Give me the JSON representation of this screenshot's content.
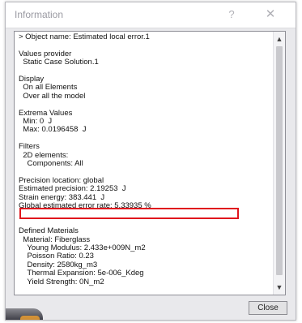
{
  "window": {
    "title": "Information",
    "help_glyph": "?",
    "close_glyph": "✕"
  },
  "info_lines": [
    "> Object name: Estimated local error.1",
    "",
    "Values provider",
    "  Static Case Solution.1",
    "",
    "Display",
    "  On all Elements",
    "  Over all the model",
    "",
    "Extrema Values",
    "  Min: 0  J",
    "  Max: 0.0196458  J",
    "",
    "Filters",
    "  2D elements:",
    "    Components: All",
    "",
    "Precision location: global",
    "Estimated precision: 2.19253  J",
    "Strain energy: 383.441  J",
    "Global estimated error rate: 5.33935 %",
    "",
    "",
    "Defined Materials",
    "  Material: Fiberglass",
    "    Young Modulus: 2.433e+009N_m2",
    "    Poisson Ratio: 0.23",
    "    Density: 2580kg_m3",
    "    Thermal Expansion: 5e-006_Kdeg",
    "    Yield Strength: 0N_m2"
  ],
  "scrollbar": {
    "up_glyph": "▲",
    "down_glyph": "▼"
  },
  "footer": {
    "close_label": "Close"
  },
  "colors": {
    "highlight": "#e0161d"
  }
}
